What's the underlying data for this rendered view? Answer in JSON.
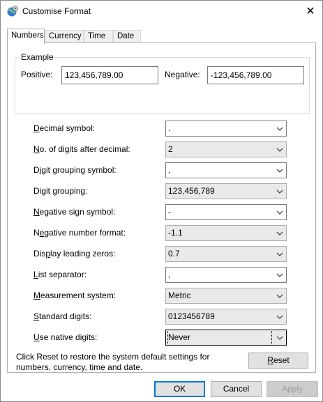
{
  "window": {
    "title": "Customise Format",
    "close_label": "✕"
  },
  "tabs": [
    {
      "label": "Numbers"
    },
    {
      "label": "Currency"
    },
    {
      "label": "Time"
    },
    {
      "label": "Date"
    }
  ],
  "example": {
    "title": "Example",
    "positive_label": "Positive:",
    "positive_value": "123,456,789.00",
    "negative_label": "Negative:",
    "negative_value": "-123,456,789.00"
  },
  "settings": [
    {
      "label_pre": "",
      "label_key": "D",
      "label_post": "ecimal symbol:",
      "value": "."
    },
    {
      "label_pre": "",
      "label_key": "N",
      "label_post": "o. of digits after decimal:",
      "value": "2"
    },
    {
      "label_pre": "D",
      "label_key": "i",
      "label_post": "git grouping symbol:",
      "value": ","
    },
    {
      "label_pre": "Digit ",
      "label_key": "g",
      "label_post": "rouping:",
      "value": "123,456,789"
    },
    {
      "label_pre": "",
      "label_key": "N",
      "label_post": "egative sign symbol:",
      "value": "-"
    },
    {
      "label_pre": "N",
      "label_key": "e",
      "label_post": "gative number format:",
      "value": "-1.1"
    },
    {
      "label_pre": "Dis",
      "label_key": "p",
      "label_post": "lay leading zeros:",
      "value": "0.7"
    },
    {
      "label_pre": "",
      "label_key": "L",
      "label_post": "ist separator:",
      "value": ","
    },
    {
      "label_pre": "",
      "label_key": "M",
      "label_post": "easurement system:",
      "value": "Metric"
    },
    {
      "label_pre": "",
      "label_key": "S",
      "label_post": "tandard digits:",
      "value": "0123456789"
    },
    {
      "label_pre": "",
      "label_key": "U",
      "label_post": "se native digits:",
      "value": "Never"
    }
  ],
  "footer": {
    "note": "Click Reset to restore the system default settings for numbers, currency, time and date.",
    "reset_key": "R",
    "reset_rest": "eset"
  },
  "buttons": {
    "ok": "OK",
    "cancel": "Cancel",
    "apply": "Apply"
  },
  "colors": {
    "focus_blue": "#0078d7"
  }
}
